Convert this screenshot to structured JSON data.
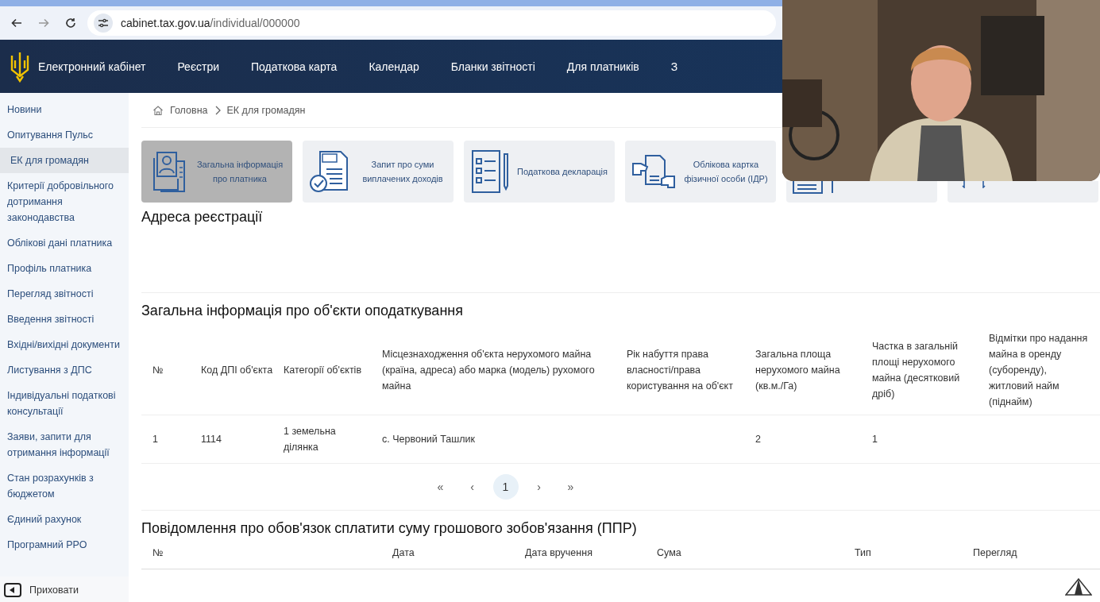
{
  "browser": {
    "url_host": "cabinet.tax.gov.ua",
    "url_path": "/individual/000000"
  },
  "header": {
    "brand": "Електронний кабінет",
    "nav": [
      "Реєстри",
      "Податкова карта",
      "Календар",
      "Бланки звітності",
      "Для платників",
      "З"
    ]
  },
  "sidebar": {
    "items": [
      {
        "label": "Новини",
        "selected": false
      },
      {
        "label": "Опитування Пульс",
        "selected": false
      },
      {
        "label": "ЕК для громадян",
        "selected": true
      },
      {
        "label": "Критерії добровільного дотримання законодавства",
        "selected": false
      },
      {
        "label": "Облікові дані платника",
        "selected": false
      },
      {
        "label": "Профіль платника",
        "selected": false
      },
      {
        "label": "Перегляд звітності",
        "selected": false
      },
      {
        "label": "Введення звітності",
        "selected": false
      },
      {
        "label": "Вхідні/вихідні документи",
        "selected": false
      },
      {
        "label": "Листування з ДПС",
        "selected": false
      },
      {
        "label": "Індивідуальні податкові консультації",
        "selected": false
      },
      {
        "label": "Заяви, запити для отримання інформації",
        "selected": false
      },
      {
        "label": "Стан розрахунків з бюджетом",
        "selected": false
      },
      {
        "label": "Єдиний рахунок",
        "selected": false
      },
      {
        "label": "Програмний РРО",
        "selected": false
      }
    ],
    "collapse": "Приховати"
  },
  "breadcrumb": [
    "Головна",
    "ЕК для громадян"
  ],
  "tiles": [
    {
      "kind": "person",
      "label": "Загальна інформація про платника",
      "selected": true
    },
    {
      "kind": "tax",
      "label": "Запит про суми виплачених доходів",
      "selected": false
    },
    {
      "kind": "checklist",
      "label": "Податкова декларація",
      "selected": false
    },
    {
      "kind": "handover",
      "label": "Облікова картка фізичної особи (ІДР)",
      "selected": false
    },
    {
      "kind": "form",
      "selected": false
    },
    {
      "kind": "arrows",
      "selected": false
    }
  ],
  "address_section": {
    "title": "Адреса реєстрації"
  },
  "objects_section": {
    "title": "Загальна інформація про об'єкти оподаткування",
    "columns": [
      "№",
      "Код ДПІ об'єкта",
      "Категорії об'єктів",
      "Місцезнаходження об'єкта нерухомого майна (країна, адреса) або марка (модель) рухомого майна",
      "Рік набуття права власності/права користування на об'єкт",
      "Загальна площа нерухомого майна (кв.м./Га)",
      "Частка в загальній площі нерухомого майна (десятковий дріб)",
      "Відмітки про надання майна в оренду (суборенду), житловий найм (піднайм)"
    ],
    "rows": [
      [
        "1",
        "1114",
        "1 земельна ділянка",
        "с. Червоний Ташлик",
        "",
        "2",
        "1",
        ""
      ]
    ],
    "pagination": [
      {
        "label": "«",
        "selected": false
      },
      {
        "label": "‹",
        "selected": false
      },
      {
        "label": "1",
        "selected": true
      },
      {
        "label": "›",
        "selected": false
      },
      {
        "label": "»",
        "selected": false
      }
    ]
  },
  "ppr_section": {
    "title": "Повідомлення про обов'язок сплатити суму грошового зобов'язання (ППР)",
    "columns": [
      "№",
      "Дата",
      "Дата вручення",
      "Сума",
      "Тип",
      "Перегляд"
    ]
  }
}
